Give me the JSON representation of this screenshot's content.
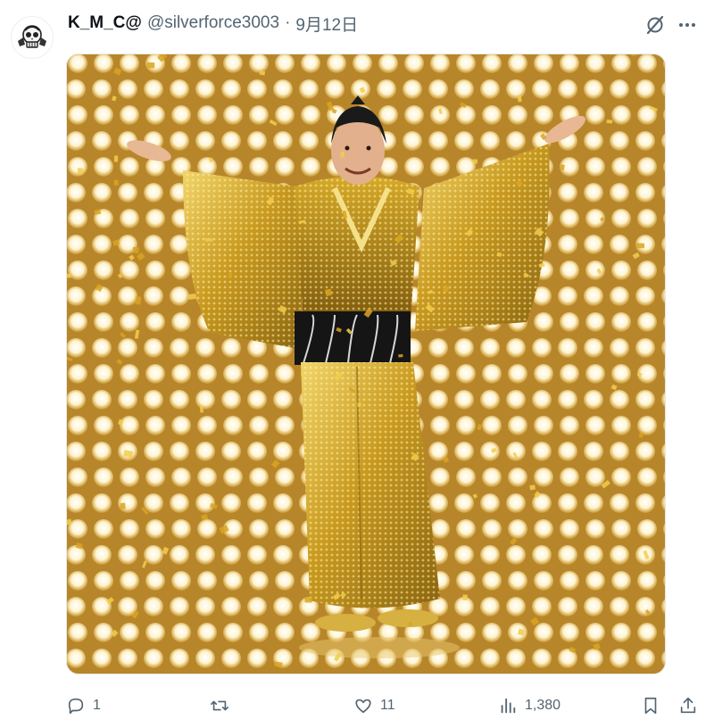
{
  "post": {
    "author": {
      "display_name": "K_M_C@",
      "handle": "@silverforce3003",
      "avatar_icon": "skull-logo-icon"
    },
    "separator": "·",
    "date": "9月12日",
    "header_icons": [
      "grok-icon",
      "more-icon"
    ],
    "media": {
      "description_icon": "photo",
      "accent_colors": [
        "#c9a227",
        "#f3e3a0",
        "#1b1b1b"
      ]
    },
    "actions": {
      "reply_count": "1",
      "repost_count": "",
      "like_count": "11",
      "views_count": "1,380"
    }
  },
  "colors": {
    "text_primary": "#0f1419",
    "text_secondary": "#536471"
  }
}
